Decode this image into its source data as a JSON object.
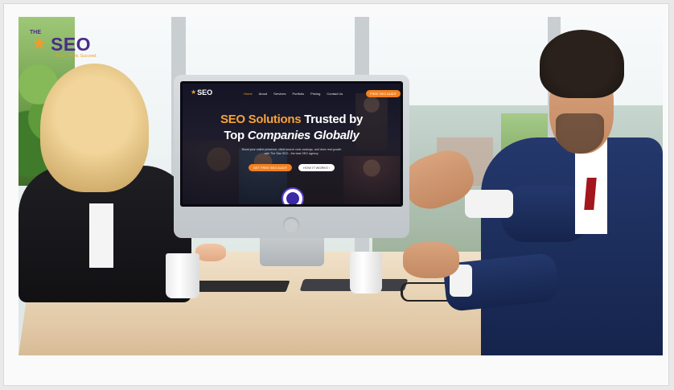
{
  "brand": {
    "logo_prefix": "THE",
    "logo_name": "SEO",
    "tagline": "Never. Think. Succeed."
  },
  "screen_site": {
    "logo_name": "SEO",
    "nav": [
      "Home",
      "About",
      "Services",
      "Portfolio",
      "Pricing",
      "Contact Us"
    ],
    "audit_button": "FREE SEO AUDIT",
    "hero_line1_orange": "SEO Solutions",
    "hero_line1_white": "Trusted by",
    "hero_line2_prefix": "Top",
    "hero_line2_italic": "Companies Globally",
    "subtext_line1": "Boost your online presence, climb search rank rankings, and drive real growth",
    "subtext_line2": "with The Star SEO - the best SEO agency.",
    "cta_primary": "GET FREE SEO AUDIT",
    "cta_secondary": "HOW IT WORKS"
  },
  "colors": {
    "accent_orange": "#f2811f",
    "brand_purple": "#4a2c8a",
    "brand_orange": "#f39a2c"
  }
}
